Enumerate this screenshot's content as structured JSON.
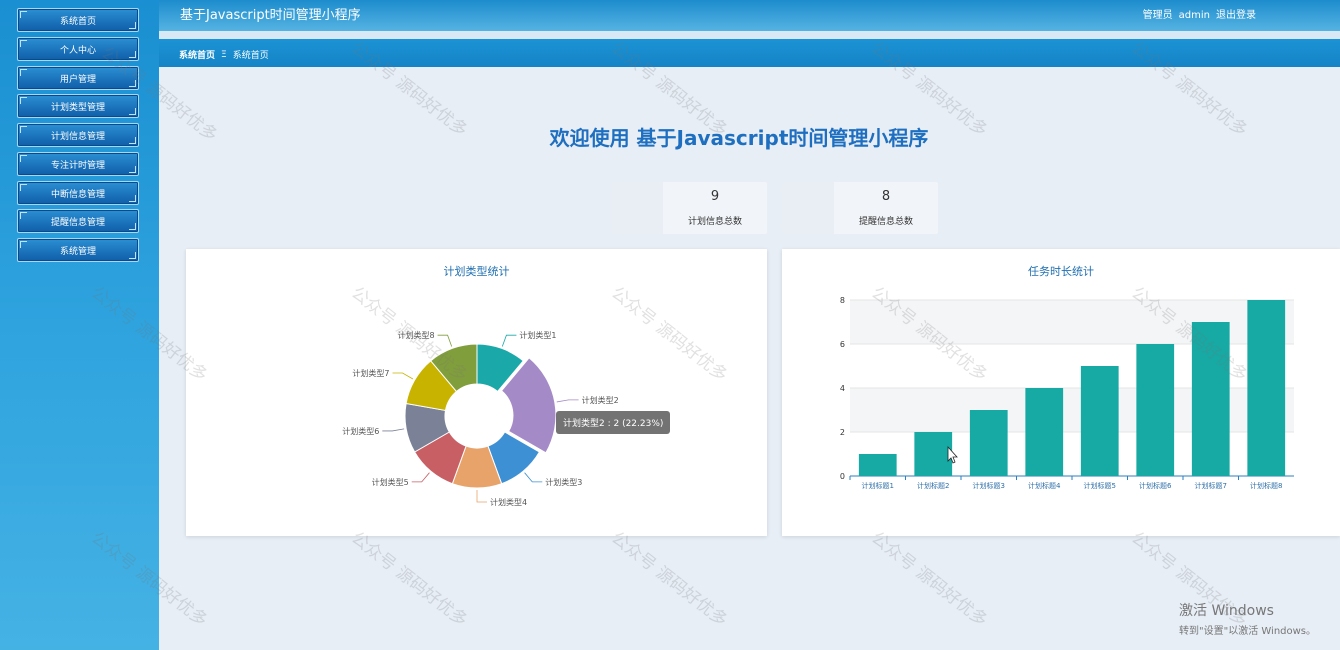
{
  "sidebar": {
    "items": [
      {
        "label": "系统首页"
      },
      {
        "label": "个人中心"
      },
      {
        "label": "用户管理"
      },
      {
        "label": "计划类型管理"
      },
      {
        "label": "计划信息管理"
      },
      {
        "label": "专注计时管理"
      },
      {
        "label": "中断信息管理"
      },
      {
        "label": "提醒信息管理"
      },
      {
        "label": "系统管理"
      }
    ]
  },
  "header": {
    "title": "基于Javascript时间管理小程序",
    "role": "管理员",
    "username": "admin",
    "logout": "退出登录"
  },
  "breadcrumb": {
    "home": "系统首页",
    "separator": "Ξ",
    "current": "系统首页"
  },
  "welcome": "欢迎使用 基于Javascript时间管理小程序",
  "stats": [
    {
      "value": "9",
      "label": "计划信息总数"
    },
    {
      "value": "8",
      "label": "提醒信息总数"
    }
  ],
  "chart_data": [
    {
      "type": "pie",
      "title": "计划类型统计",
      "categories": [
        "计划类型1",
        "计划类型2",
        "计划类型3",
        "计划类型4",
        "计划类型5",
        "计划类型6",
        "计划类型7",
        "计划类型8"
      ],
      "values": [
        1,
        2,
        1,
        1,
        1,
        1,
        1,
        1
      ],
      "colors": [
        "#1aa9a8",
        "#a48ac6",
        "#3d90d4",
        "#e8a36a",
        "#c85f64",
        "#7b8297",
        "#c7b300",
        "#809e3c"
      ],
      "tooltip": "计划类型2 : 2 (22.23%)"
    },
    {
      "type": "bar",
      "title": "任务时长统计",
      "categories": [
        "计划标题1",
        "计划标题2",
        "计划标题3",
        "计划标题4",
        "计划标题5",
        "计划标题6",
        "计划标题7",
        "计划标题8"
      ],
      "values": [
        1,
        2,
        3,
        4,
        5,
        6,
        7,
        8
      ],
      "yticks": [
        0,
        2,
        4,
        6,
        8
      ],
      "ylim": [
        0,
        8
      ],
      "color": "#17a9a4"
    }
  ],
  "watermark": "公众号 源码好优多",
  "activation": {
    "line1": "激活 Windows",
    "line2": "转到\"设置\"以激活 Windows。"
  }
}
